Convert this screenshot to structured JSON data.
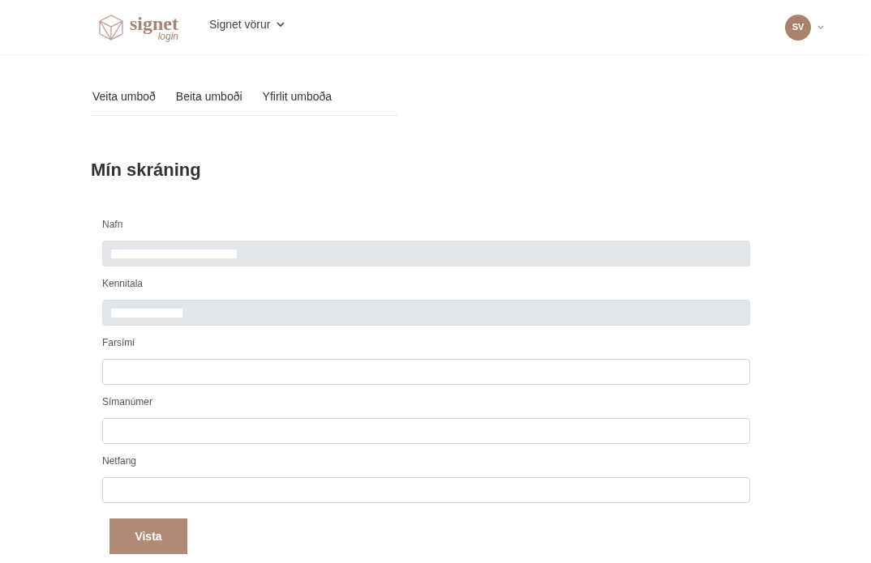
{
  "header": {
    "logo": {
      "name": "signet",
      "sub": "login"
    },
    "menu": "Signet vörur",
    "avatar": "SV"
  },
  "tabs": [
    {
      "label": "Veita umboð",
      "selected": false
    },
    {
      "label": "Beita umboði",
      "selected": false
    },
    {
      "label": "Yfirlit umboða",
      "selected": false
    }
  ],
  "title": "Mín skráning",
  "fields": [
    {
      "label": "Nafn",
      "disabled": true,
      "redacted": true
    },
    {
      "label": "Kennitala",
      "disabled": true,
      "redacted": true
    },
    {
      "label": "Farsími",
      "disabled": false,
      "redacted": false
    },
    {
      "label": "Símanúmer",
      "disabled": false,
      "redacted": false
    },
    {
      "label": "Netfang",
      "disabled": false,
      "redacted": false
    }
  ],
  "save_button": "Vista"
}
